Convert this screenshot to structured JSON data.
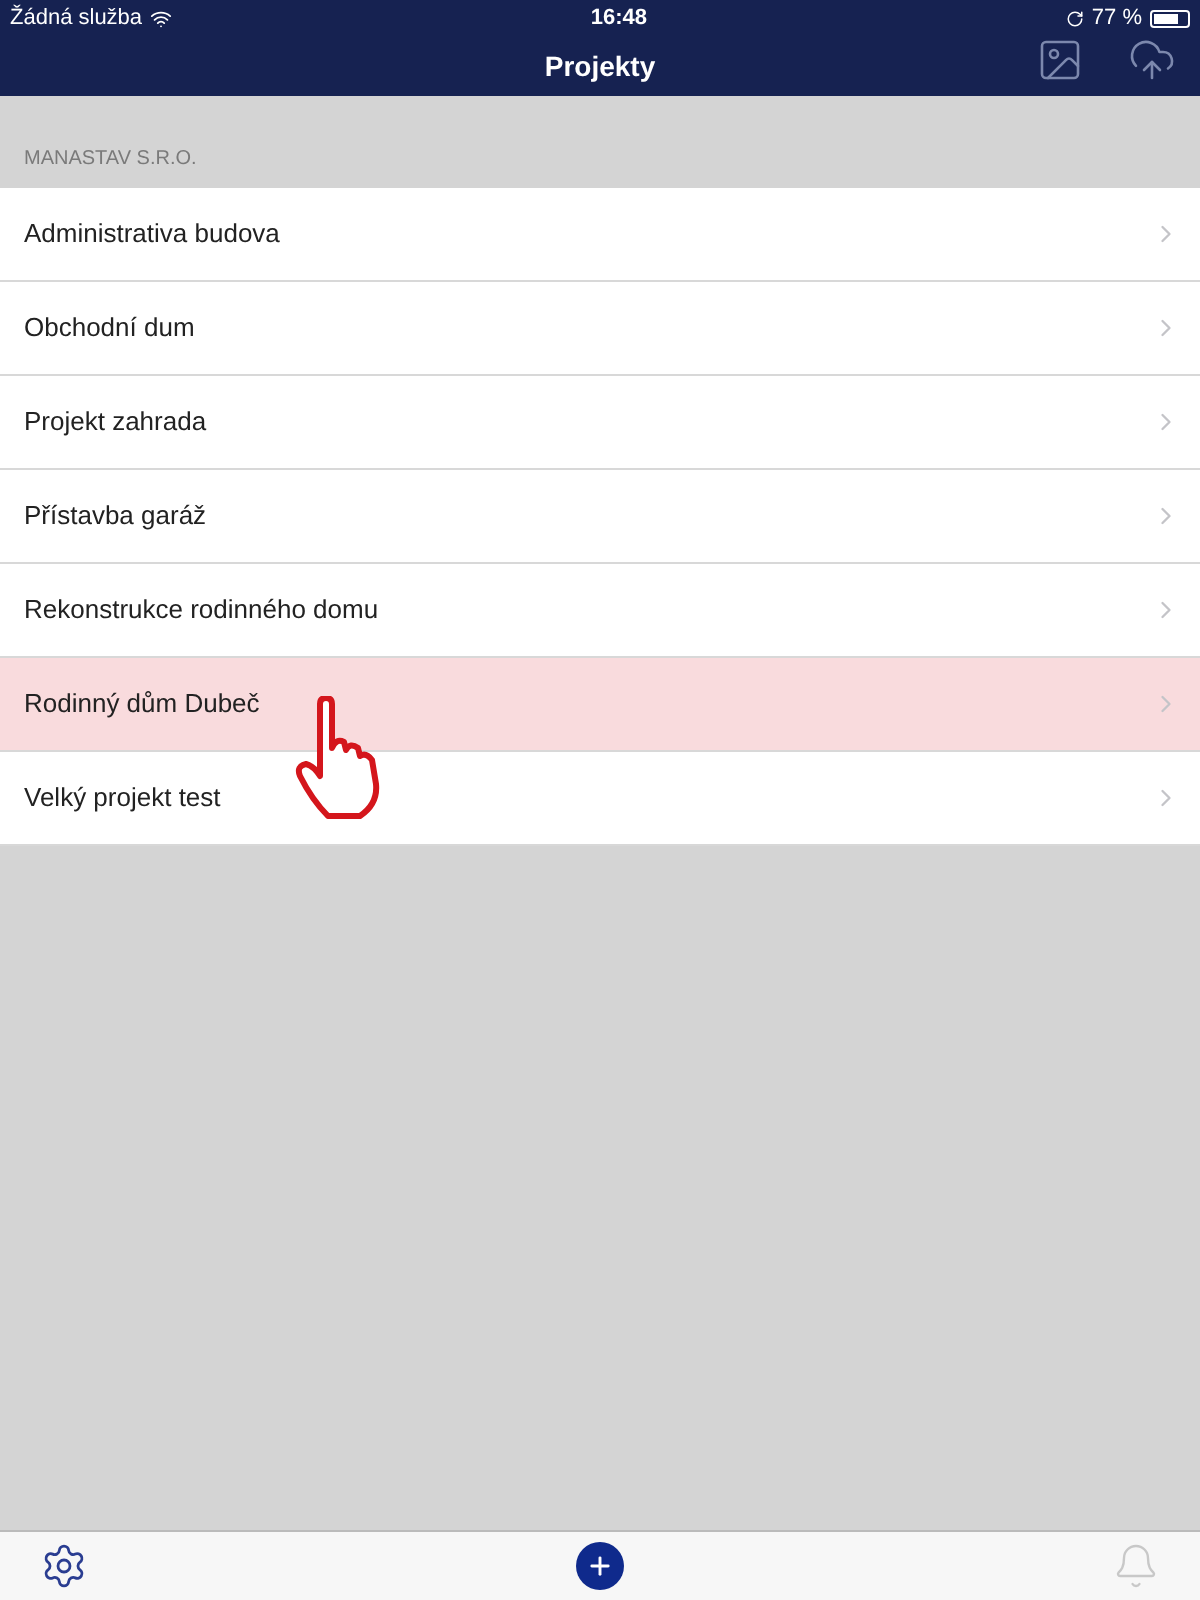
{
  "status_bar": {
    "carrier": "Žádná služba",
    "time": "16:48",
    "battery": "77 %"
  },
  "nav_bar": {
    "title": "Projekty"
  },
  "section": {
    "header": "MANASTAV S.R.O."
  },
  "projects": [
    {
      "name": "Administrativa budova",
      "selected": false
    },
    {
      "name": "Obchodní dum",
      "selected": false
    },
    {
      "name": "Projekt zahrada",
      "selected": false
    },
    {
      "name": "Přístavba garáž",
      "selected": false
    },
    {
      "name": "Rekonstrukce rodinného domu",
      "selected": false
    },
    {
      "name": "Rodinný dům Dubeč",
      "selected": true
    },
    {
      "name": "Velký projekt test",
      "selected": false
    }
  ]
}
